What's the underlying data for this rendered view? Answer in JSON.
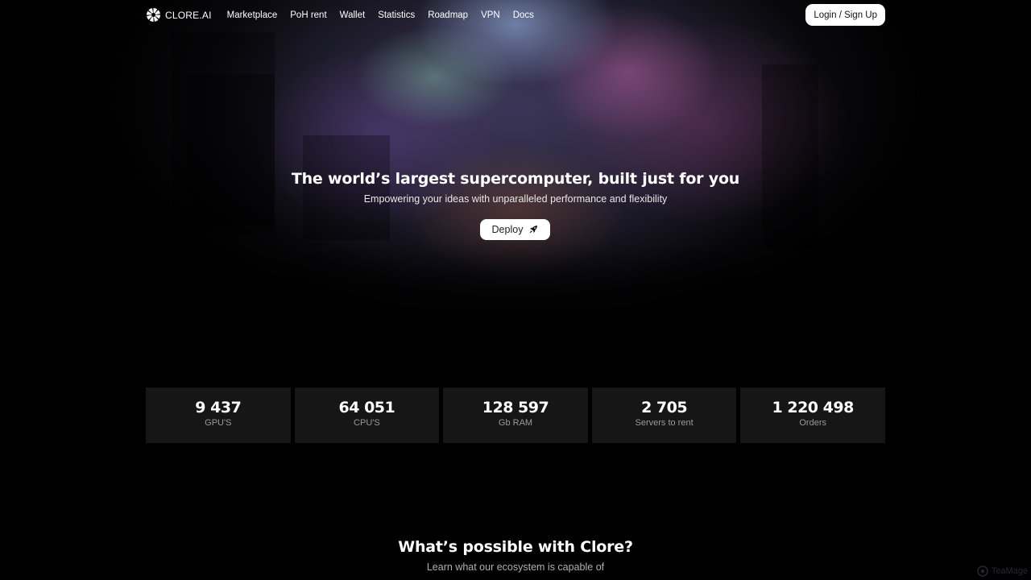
{
  "brand": {
    "name": "CLORE.AI",
    "logo_icon": "clore-swirl-icon"
  },
  "nav": {
    "links": [
      "Marketplace",
      "PoH rent",
      "Wallet",
      "Statistics",
      "Roadmap",
      "VPN",
      "Docs"
    ],
    "login_label": "Login / Sign Up"
  },
  "hero": {
    "title": "The world’s largest supercomputer, built just for you",
    "subtitle": "Empowering your ideas with unparalleled performance and flexibility",
    "deploy_label": "Deploy",
    "deploy_icon": "rocket-icon"
  },
  "stats": [
    {
      "value": "9 437",
      "label": "GPU'S"
    },
    {
      "value": "64 051",
      "label": "CPU'S"
    },
    {
      "value": "128 597",
      "label": "Gb RAM"
    },
    {
      "value": "2 705",
      "label": "Servers to rent"
    },
    {
      "value": "1 220 498",
      "label": "Orders"
    }
  ],
  "section": {
    "title": "What’s possible with Clore?",
    "subtitle": "Learn what our ecosystem is capable of"
  },
  "watermark": {
    "text": "TeaMage"
  },
  "colors": {
    "background": "#000000",
    "card": "#161616",
    "button": "#ffffff",
    "muted_text": "#9a9a9a"
  }
}
